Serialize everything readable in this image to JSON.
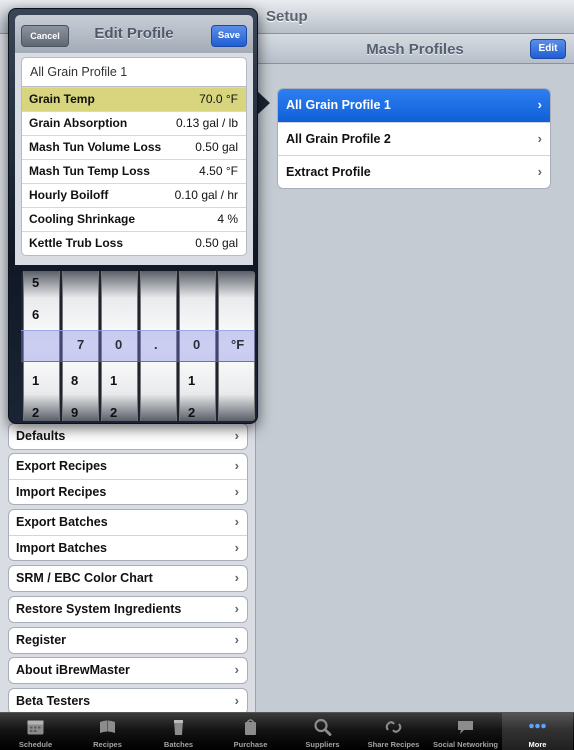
{
  "navbar": {
    "title": "Setup"
  },
  "detail": {
    "title": "Mash Profiles",
    "edit_label": "Edit",
    "items": [
      {
        "label": "All Grain Profile 1",
        "selected": true
      },
      {
        "label": "All Grain Profile 2",
        "selected": false
      },
      {
        "label": "Extract Profile",
        "selected": false
      }
    ]
  },
  "popover": {
    "title": "Edit Profile",
    "cancel_label": "Cancel",
    "save_label": "Save",
    "profile_name": "All Grain Profile 1",
    "properties": [
      {
        "label": "Grain Temp",
        "value": "70.0 °F",
        "highlight": true
      },
      {
        "label": "Grain Absorption",
        "value": "0.13 gal / lb",
        "highlight": false
      },
      {
        "label": "Mash Tun Volume Loss",
        "value": "0.50 gal",
        "highlight": false
      },
      {
        "label": "Mash Tun Temp Loss",
        "value": "4.50 °F",
        "highlight": false
      },
      {
        "label": "Hourly Boiloff",
        "value": "0.10 gal / hr",
        "highlight": false
      },
      {
        "label": "Cooling Shrinkage",
        "value": "4 %",
        "highlight": false
      },
      {
        "label": "Kettle Trub Loss",
        "value": "0.50 gal",
        "highlight": false
      }
    ],
    "picker": {
      "wheel1": {
        "above2": "5",
        "above1": "6",
        "selected": "7",
        "below1": "1",
        "below2": "2"
      },
      "wheel2": {
        "above2": "",
        "above1": "",
        "selected": "0",
        "below1": "8",
        "below2": "9"
      },
      "wheel3": {
        "above2": "",
        "above1": "",
        "selected": ".",
        "below1": "1",
        "below2": "2"
      },
      "wheel4": {
        "above2": "",
        "above1": "",
        "selected": "0",
        "below1": "1",
        "below2": "2"
      },
      "unit": "°F"
    }
  },
  "menu": {
    "groups": [
      [
        "Defaults"
      ],
      [
        "Export Recipes",
        "Import Recipes"
      ],
      [
        "Export Batches",
        "Import Batches"
      ],
      [
        "SRM / EBC Color Chart"
      ],
      [
        "Restore System Ingredients"
      ],
      [
        "Register"
      ],
      [
        "About iBrewMaster"
      ],
      [
        "Beta Testers"
      ]
    ]
  },
  "tabbar": {
    "tabs": [
      {
        "label": "Schedule",
        "icon": "calendar-icon"
      },
      {
        "label": "Recipes",
        "icon": "recipe-book-icon"
      },
      {
        "label": "Batches",
        "icon": "beer-glass-icon"
      },
      {
        "label": "Purchase",
        "icon": "shopping-icon"
      },
      {
        "label": "Suppliers",
        "icon": "search-icon"
      },
      {
        "label": "Share Recipes",
        "icon": "share-arrows-icon"
      },
      {
        "label": "Social Networking",
        "icon": "chat-bubble-icon"
      },
      {
        "label": "More",
        "icon": "more-dots-icon",
        "active": true
      }
    ]
  }
}
